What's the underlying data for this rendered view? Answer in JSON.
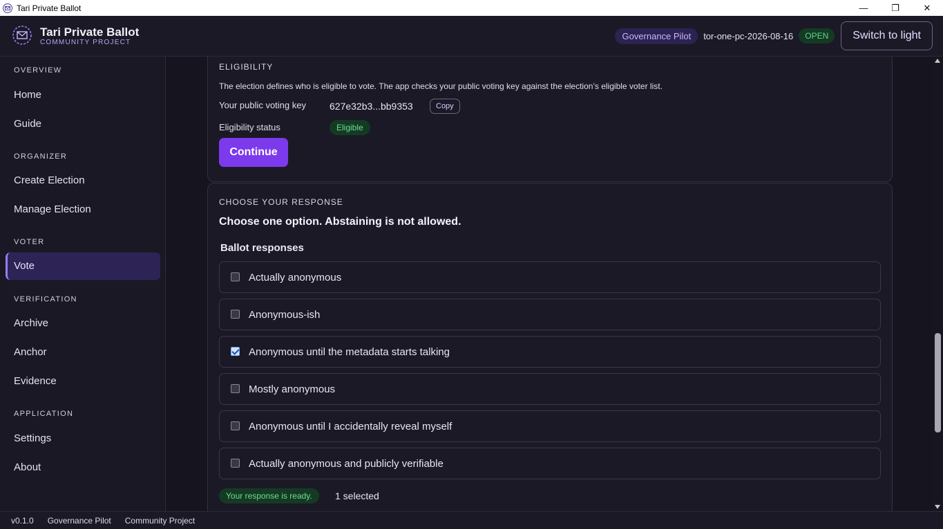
{
  "window": {
    "title": "Tari Private Ballot",
    "min": "—",
    "max": "❐",
    "close": "✕"
  },
  "header": {
    "title": "Tari Private Ballot",
    "subtitle": "COMMUNITY PROJECT",
    "pilot_badge": "Governance Pilot",
    "election_id": "tor-one-pc-2026-08-16",
    "status": "OPEN",
    "theme_button": "Switch to light"
  },
  "sidebar": {
    "sections": [
      {
        "title": "OVERVIEW",
        "items": [
          "Home",
          "Guide"
        ]
      },
      {
        "title": "ORGANIZER",
        "items": [
          "Create Election",
          "Manage Election"
        ]
      },
      {
        "title": "VOTER",
        "items": [
          "Vote"
        ]
      },
      {
        "title": "VERIFICATION",
        "items": [
          "Archive",
          "Anchor",
          "Evidence"
        ]
      },
      {
        "title": "APPLICATION",
        "items": [
          "Settings",
          "About"
        ]
      }
    ],
    "active": "Vote"
  },
  "eligibility": {
    "heading": "ELIGIBILITY",
    "description": "The election defines who is eligible to vote. The app checks your public voting key against the election’s eligible voter list.",
    "key_label": "Your public voting key",
    "key_value": "627e32b3...bb9353",
    "copy_button": "Copy",
    "status_label": "Eligibility status",
    "status_value": "Eligible",
    "continue_button": "Continue"
  },
  "response": {
    "heading": "CHOOSE YOUR RESPONSE",
    "instruction": "Choose one option. Abstaining is not allowed.",
    "list_title": "Ballot responses",
    "options": [
      {
        "label": "Actually anonymous",
        "checked": false
      },
      {
        "label": "Anonymous-ish",
        "checked": false
      },
      {
        "label": "Anonymous until the metadata starts talking",
        "checked": true
      },
      {
        "label": "Mostly anonymous",
        "checked": false
      },
      {
        "label": "Anonymous until I accidentally reveal myself",
        "checked": false
      },
      {
        "label": "Actually anonymous and publicly verifiable",
        "checked": false
      }
    ],
    "ready_badge": "Your response is ready.",
    "selected_count": "1 selected"
  },
  "footer": {
    "version": "v0.1.0",
    "pilot": "Governance Pilot",
    "project": "Community Project"
  },
  "colors": {
    "accent": "#7c3aed",
    "success": "#6fdc97",
    "background": "#16141f"
  }
}
